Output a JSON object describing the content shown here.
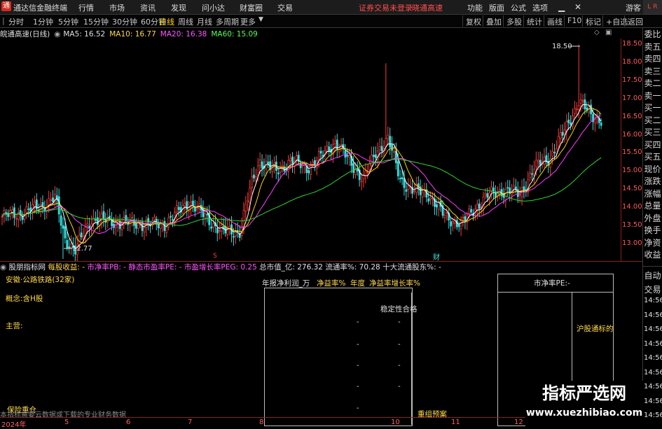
{
  "app": {
    "logo_glyph": "通",
    "title": "通达信金融终端",
    "menu": [
      "行情",
      "市场",
      "资讯",
      "发现",
      "问小达",
      "财富圈",
      "交易"
    ],
    "notice": "证券交易未登录",
    "notice2": "晓通高速",
    "right_menu": [
      "功能",
      "版面",
      "公式",
      "选项"
    ],
    "user": "游客",
    "corner_badge": "L R"
  },
  "toolbar": {
    "timeframes": [
      "分时",
      "1分钟",
      "5分钟",
      "15分钟",
      "30分钟",
      "60分钟",
      "日线",
      "周线",
      "月线",
      "多周期",
      "更多"
    ],
    "active": "日线",
    "right_tools": [
      "复权",
      "叠加",
      "多股",
      "统计",
      "画线",
      "F10",
      "标记",
      "+自选",
      "返回"
    ]
  },
  "legend": {
    "stock": "皖通高速(日线)",
    "ma5": "MA5: 16.52",
    "ma10": "MA10: 16.77",
    "ma20": "MA20: 16.38",
    "ma60": "MA60: 15.09"
  },
  "price_axis": [
    "18.50",
    "18.00",
    "17.50",
    "17.00",
    "16.50",
    "16.00",
    "15.50",
    "15.00",
    "14.50",
    "14.00",
    "13.50",
    "13.00"
  ],
  "chart_annotations": {
    "high_label": "18.50",
    "low_label": "12.77",
    "marker_s": "S",
    "marker_cai": "财"
  },
  "right_rail": {
    "labels": [
      "委比",
      "卖五",
      "卖四",
      "卖三",
      "卖二",
      "卖一",
      "买一",
      "买二",
      "买三",
      "买四",
      "买五",
      "现价",
      "涨跌",
      "涨幅",
      "总量",
      "外盘",
      "换手",
      "净资",
      "收益"
    ],
    "bottom_labels": [
      "自动",
      "交易"
    ],
    "time_labels": [
      "14:56",
      "14:56",
      "14:56",
      "14:56",
      "14:56",
      "14:56",
      "14:56",
      "14:56",
      "14:56"
    ]
  },
  "indicator": {
    "name": "股朋指标网",
    "eps": "每股收益: -",
    "pb": "市净率PB: -",
    "pe": "静态市盈率PE: -",
    "peg": "市盈增长率PEG: 0.25",
    "mktcap": "总市值_亿: 276.32",
    "float_ratio": "流通率%: 70.28",
    "top10": "十大流通股东%: -"
  },
  "fundamentals": {
    "industry": "安徽·公路铁路(32家)",
    "concept": "概念:含H股",
    "main_business": "主营:",
    "insurance": "保险重仓",
    "footer_note": "本指标需要云数据或下载的专业财务数据",
    "col_headers": [
      "年报净利润_万",
      "净益率%",
      "年度",
      "净益率增长率%"
    ],
    "stability": "稳定性合格",
    "dash": "-",
    "restructure": "重组预案",
    "pe_box_title": "市净率PE:-",
    "hk_connect": "沪股通标的"
  },
  "date_axis": [
    "2024年",
    "5",
    "6",
    "7",
    "8",
    "10",
    "11",
    "12"
  ],
  "watermark": {
    "text": "指标严选网",
    "url": "www.xuezhibiao.com"
  },
  "colors": {
    "up": "#ff3b3b",
    "down": "#35e0e0",
    "ma5": "#ffffff",
    "ma10": "#ffd700",
    "ma20": "#ff40ff",
    "ma60": "#2fd62f"
  }
}
